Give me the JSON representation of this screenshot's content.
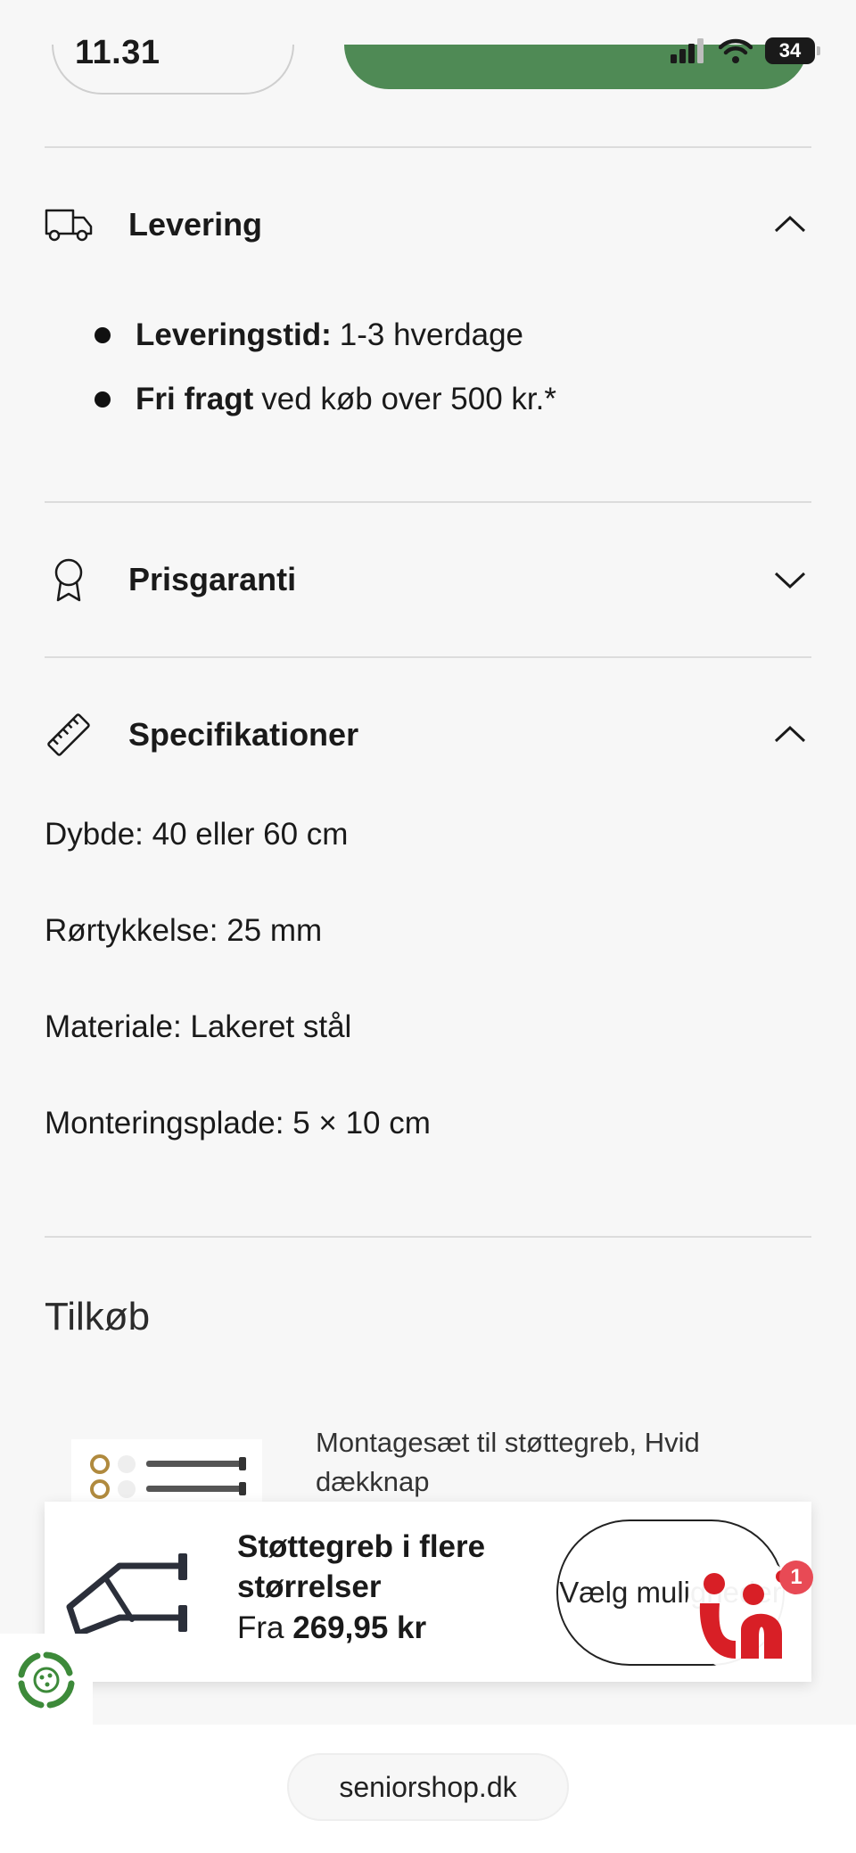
{
  "status_bar": {
    "time": "11.31",
    "battery": "34"
  },
  "delivery": {
    "title": "Levering",
    "items": [
      {
        "label": "Leveringstid:",
        "value": "1-3 hverdage"
      },
      {
        "label": "Fri fragt",
        "value": "ved køb over 500 kr.*"
      }
    ]
  },
  "price_guarantee": {
    "title": "Prisgaranti"
  },
  "specifications": {
    "title": "Specifikationer",
    "items": [
      "Dybde: 40 eller 60 cm",
      "Rørtykkelse: 25 mm",
      "Materiale: Lakeret stål",
      "Monteringsplade: 5 × 10 cm"
    ]
  },
  "addons": {
    "title": "Tilkøb",
    "item_title": "Montagesæt til støttegreb, Hvid dækknap"
  },
  "sticky_product": {
    "name": "Støttegreb i flere størrelser",
    "price_prefix": "Fra",
    "price": "269,95 kr",
    "button_label": "Vælg muligheder"
  },
  "chat": {
    "badge_count": "1"
  },
  "browser": {
    "url": "seniorshop.dk"
  },
  "colors": {
    "accent_green": "#4f8a55",
    "badge_red": "#e84a55",
    "chat_red": "#d81f26"
  }
}
